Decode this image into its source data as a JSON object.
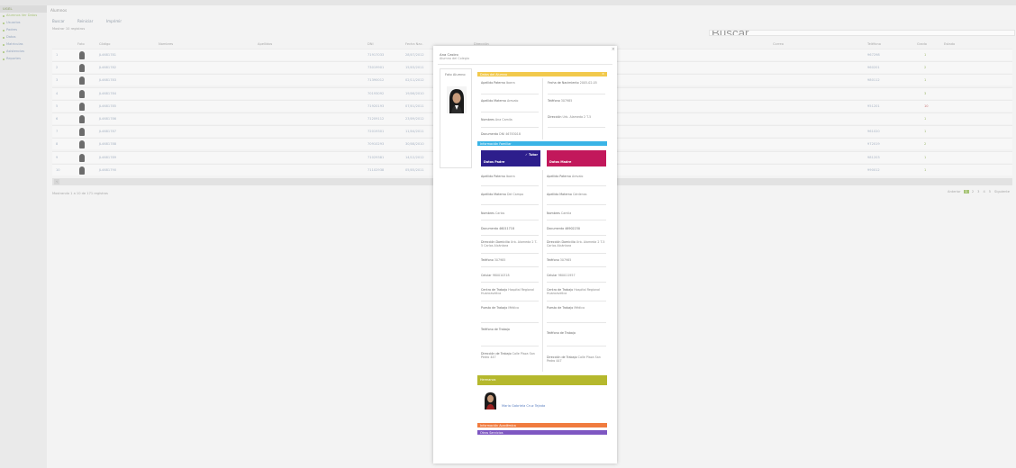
{
  "sidebar": {
    "brand": "UGEL",
    "items": [
      {
        "label": "Alumnos Ver Datos"
      },
      {
        "label": "Usuarios"
      },
      {
        "label": "Padres"
      },
      {
        "label": "Datos"
      },
      {
        "label": "Matriculas"
      },
      {
        "label": "Asistencias"
      },
      {
        "label": "Reportes"
      }
    ]
  },
  "header": {
    "title": "Alumnos",
    "tools": [
      "Buscar",
      "Reiniciar",
      "Imprimir"
    ],
    "filter": "Mostrar 10 registros",
    "search_placeholder": "Buscar"
  },
  "table": {
    "columns": [
      "Foto",
      "Código",
      "Nombres",
      "Apellidos",
      "DNI",
      "Fecha Nac.",
      "Dirección",
      "Correo",
      "Teléfono",
      "Grado",
      "Estado"
    ],
    "rows": [
      {
        "n": "1",
        "code": "JL4681781",
        "dni": "71917033",
        "fecha": "28/07/2012",
        "phone": "967298",
        "grado": "1",
        "flag": "green"
      },
      {
        "n": "2",
        "code": "JL4681782",
        "dni": "73019901",
        "fecha": "15/03/2011",
        "phone": "960201",
        "grado": "2",
        "flag": "green"
      },
      {
        "n": "3",
        "code": "JL4681783",
        "dni": "71390012",
        "fecha": "02/11/2012",
        "phone": "980112",
        "grado": "1",
        "flag": "green"
      },
      {
        "n": "4",
        "code": "JL4681784",
        "dni": "70193092",
        "fecha": "19/06/2010",
        "phone": "",
        "grado": "3",
        "flag": "green"
      },
      {
        "n": "5",
        "code": "JL4681785",
        "dni": "71920193",
        "fecha": "07/01/2011",
        "phone": "951201",
        "grado": "10",
        "flag": "red"
      },
      {
        "n": "6",
        "code": "JL4681786",
        "dni": "71209112",
        "fecha": "23/09/2012",
        "phone": "",
        "grado": "1",
        "flag": "green"
      },
      {
        "n": "7",
        "code": "JL4681787",
        "dni": "72019301",
        "fecha": "11/04/2011",
        "phone": "961020",
        "grado": "1",
        "flag": "green"
      },
      {
        "n": "8",
        "code": "JL4681788",
        "dni": "70910293",
        "fecha": "30/08/2010",
        "phone": "972019",
        "grado": "2",
        "flag": "green"
      },
      {
        "n": "9",
        "code": "JL4681789",
        "dni": "71029381",
        "fecha": "14/12/2012",
        "phone": "981203",
        "grado": "1",
        "flag": "green"
      },
      {
        "n": "10",
        "code": "JL4681790",
        "dni": "71102938",
        "fecha": "05/05/2011",
        "phone": "990012",
        "grado": "1",
        "flag": "green"
      }
    ],
    "footer_info": "Mostrando 1 a 10 de 171 registros",
    "pager": [
      "Anterior",
      "1",
      "2",
      "3",
      "4",
      "5",
      "Siguiente"
    ]
  },
  "modal": {
    "close": "×",
    "title": "Ana Castro",
    "subtitle": "Alumno del Colegio",
    "photo_label": "Foto Alumno",
    "sections": {
      "datos": "Datos del Alumno",
      "familia": "Información Familiar",
      "hermanos": "Hermanos",
      "academica": "Información Académica",
      "otros": "Otros Servicios"
    },
    "student": {
      "ap_paterno_label": "Apellido Paterno",
      "ap_paterno": "Ibarra",
      "fecha_label": "Fecha de Nacimiento",
      "fecha": "2005-02-05",
      "ap_materno_label": "Apellido Materno",
      "ap_materno": "Arevalo",
      "telefono_label": "Teléfono",
      "telefono": "307985",
      "nombres_label": "Nombres",
      "nombres": "Ana Camila",
      "direccion_label": "Dirección",
      "direccion": "Urb. Alameda 2 T-5",
      "documento_label": "Documento",
      "documento": "DNI 46783018"
    },
    "tutor": "Tutor",
    "padre": {
      "label": "Datos Padre",
      "ap_paterno_label": "Apellido Paterno",
      "ap_paterno": "Ibarra",
      "ap_materno_label": "Apellido Materno",
      "ap_materno": "Del Campo",
      "nombres_label": "Nombres",
      "nombres": "Carlos",
      "documento": "Documento 46011718",
      "direccion_label": "Dirección Domicilio",
      "direccion": "Urb. Alameda 2 T-5 Carlos Alcántara",
      "telefono_label": "Teléfono",
      "telefono": "307985",
      "celular_label": "Celular",
      "celular": "980010318",
      "centro_label": "Centro de Trabajo",
      "centro": "Hospital Regional Huancavelica",
      "puesto_label": "Puesto de Trabajo",
      "puesto": "Médico",
      "telefono_trabajo_label": "Teléfono de Trabajo",
      "telefono_trabajo": "",
      "direccion_trabajo_label": "Dirección de Trabajo",
      "direccion_trabajo": "Calle Plaza San Pedro 447"
    },
    "madre": {
      "label": "Datos Madre",
      "ap_paterno_label": "Apellido Paterno",
      "ap_paterno": "Arevalo",
      "ap_materno_label": "Apellido Materno",
      "ap_materno": "Cárdenas",
      "nombres_label": "Nombres",
      "nombres": "Camila",
      "documento": "Documento 46902230",
      "direccion_label": "Dirección Domicilio",
      "direccion": "Urb. Alameda 2 T-5 Carlos Alcántara",
      "telefono_label": "Teléfono",
      "telefono": "307985",
      "celular_label": "Celular",
      "celular": "980011957",
      "centro_label": "Centro de Trabajo",
      "centro": "Hospital Regional Huancavelica",
      "puesto_label": "Puesto de Trabajo",
      "puesto": "Médico",
      "telefono_trabajo_label": "Teléfono de Trabajo",
      "telefono_trabajo": "",
      "direccion_trabajo_label": "Dirección de Trabajo",
      "direccion_trabajo": "Calle Plaza San Pedro 447"
    },
    "sibling": {
      "name": "Maria Gabriela Cruz Tejada"
    }
  },
  "colors": {
    "accent_green": "#8ab04a",
    "datos_bar": "#f2c94c",
    "familia_bar": "#3ab4e6",
    "padre_box": "#2d1e8c",
    "madre_box": "#c2185b",
    "hermanos_bar": "#b5b82d",
    "academica_bar": "#f07b3f",
    "otros_bar": "#7e57c2"
  }
}
